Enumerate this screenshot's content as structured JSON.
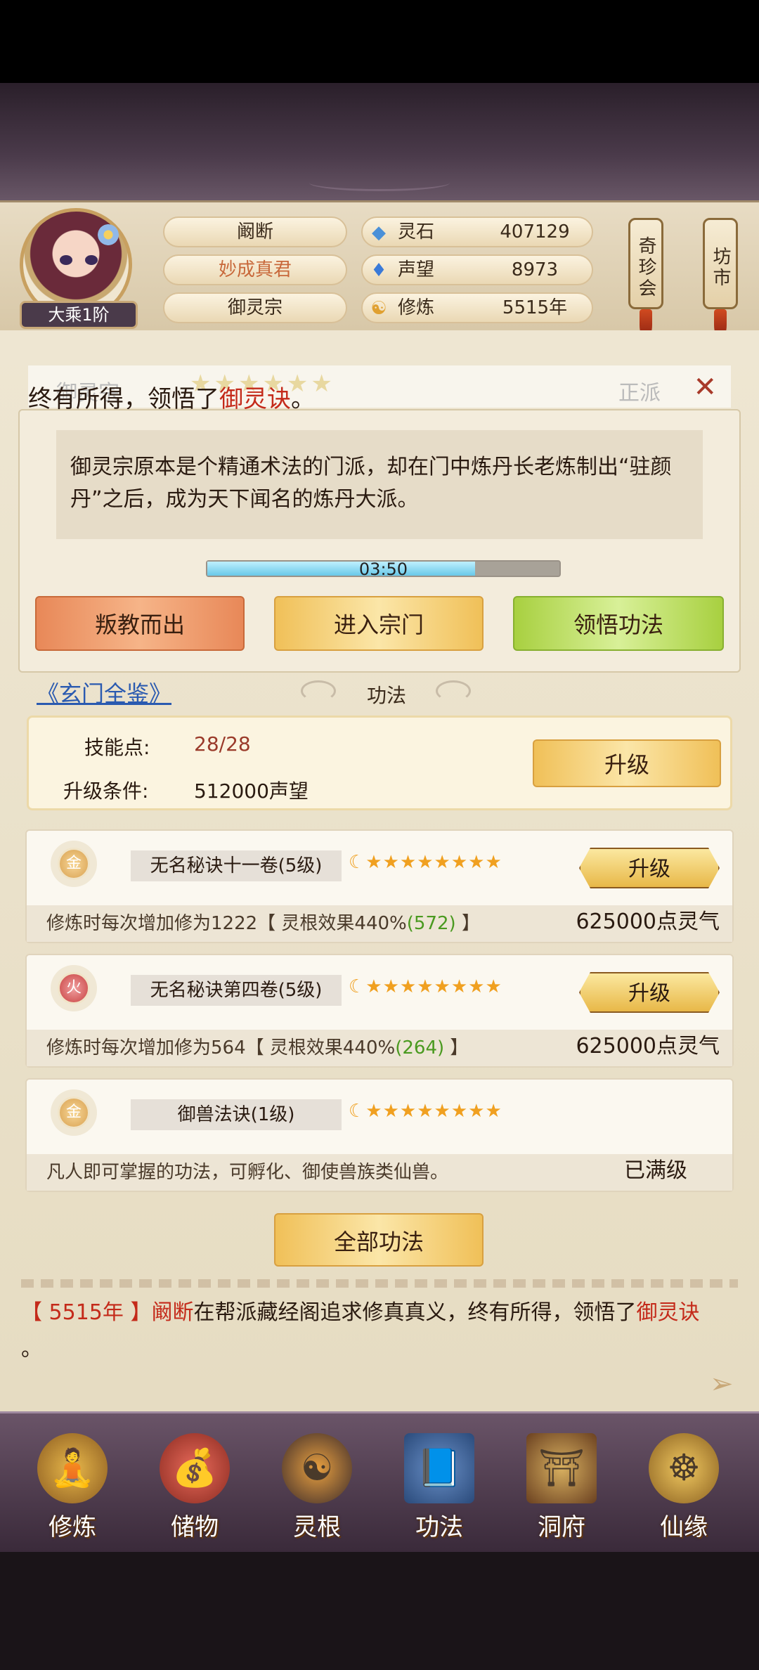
{
  "player": {
    "name": "阚断",
    "title": "妙成真君",
    "sect": "御灵宗",
    "rank": "大乘1阶"
  },
  "stats": [
    {
      "icon": "spirit-stone-icon",
      "label": "灵石",
      "value": "407129"
    },
    {
      "icon": "reputation-icon",
      "label": "声望",
      "value": "8973"
    },
    {
      "icon": "meditation-icon",
      "label": "修炼",
      "value": "5515年"
    }
  ],
  "side_buttons": {
    "treasure": "奇珍会",
    "market": "坊市"
  },
  "faded_header": {
    "left": "御灵宗",
    "right": "正派"
  },
  "notice": {
    "prefix": "终有所得，领悟了",
    "highlight": "御灵诀",
    "suffix": "。"
  },
  "sect_description": "御灵宗原本是个精通术法的门派，却在门中炼丹长老炼制出“驻颜丹”之后，成为天下闻名的炼丹大派。",
  "progress": {
    "text": "03:50",
    "fraction": 0.76
  },
  "actions": {
    "betray": "叛教而出",
    "enter": "进入宗门",
    "comprehend": "领悟功法"
  },
  "section": {
    "link": "《玄门全鉴》",
    "title": "功法"
  },
  "skill_points": {
    "label": "技能点:",
    "value": "28/28",
    "cond_label": "升级条件:",
    "cond_value": "512000声望",
    "upgrade": "升级"
  },
  "techniques": [
    {
      "element": "金",
      "name": "无名秘诀十一卷(5级)",
      "stars": "☾★★★★★★★★",
      "desc_a": "修炼时每次增加修为1222【 灵根效果440%",
      "desc_g": "(572)",
      "desc_b": " 】",
      "cost": "625000点灵气",
      "button": "升级"
    },
    {
      "element": "火",
      "name": "无名秘诀第四卷(5级)",
      "stars": "☾★★★★★★★★",
      "desc_a": "修炼时每次增加修为564【 灵根效果440%",
      "desc_g": "(264)",
      "desc_b": " 】",
      "cost": "625000点灵气",
      "button": "升级"
    },
    {
      "element": "金",
      "name": "御兽法诀(1级)",
      "stars": "☾★★★★★★★★",
      "desc_a": "凡人即可掌握的功法，可孵化、御使兽族类仙兽。",
      "desc_g": "",
      "desc_b": "",
      "cost": "已满级"
    }
  ],
  "all_button": "全部功法",
  "log": {
    "year": "5515年",
    "bracket_open": "【 ",
    "bracket_close": " 】",
    "name": "阚断",
    "mid": "在帮派藏经阁追求修真真义，终有所得，领悟了",
    "skill": "御灵诀",
    "end": "。"
  },
  "nav": [
    {
      "label": "修炼",
      "icon": "meditate-figure-icon"
    },
    {
      "label": "储物",
      "icon": "storage-bag-icon"
    },
    {
      "label": "灵根",
      "icon": "spirit-root-icon"
    },
    {
      "label": "功法",
      "icon": "manual-book-icon"
    },
    {
      "label": "洞府",
      "icon": "cave-house-icon"
    },
    {
      "label": "仙缘",
      "icon": "immortal-fate-icon"
    }
  ],
  "colors": {
    "accent_red": "#c42a1a",
    "link_blue": "#2a5ab0",
    "green": "#4a9a20"
  }
}
